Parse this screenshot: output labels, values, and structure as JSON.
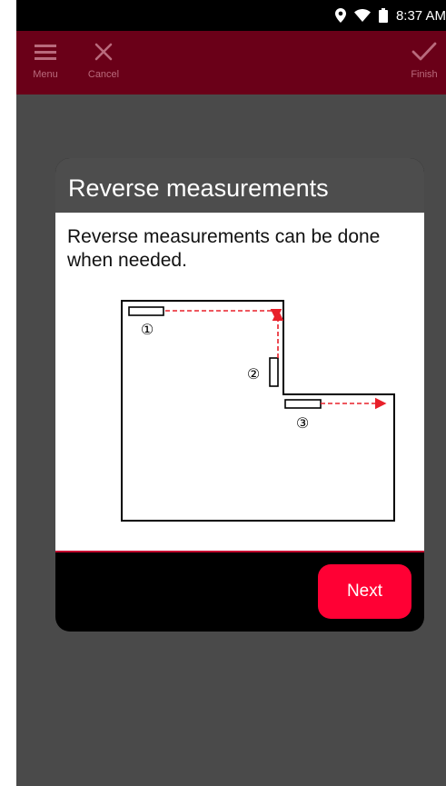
{
  "status_bar": {
    "time": "8:37 AM",
    "icons": [
      "location-icon",
      "wifi-icon",
      "battery-icon"
    ]
  },
  "toolbar": {
    "menu_label": "Menu",
    "cancel_label": "Cancel",
    "finish_label": "Finish",
    "icons": [
      "hamburger-menu-icon",
      "close-icon",
      "checkmark-icon"
    ]
  },
  "dialog": {
    "title": "Reverse measurements",
    "body": "Reverse measurements can be done when needed.",
    "diagram": {
      "steps": [
        "①",
        "②",
        "③"
      ]
    },
    "next_label": "Next"
  },
  "colors": {
    "toolbar_bg": "#6a0018",
    "accent": "#ff0034",
    "arrow": "#e8202a",
    "screen_bg": "#4a4a4a"
  }
}
